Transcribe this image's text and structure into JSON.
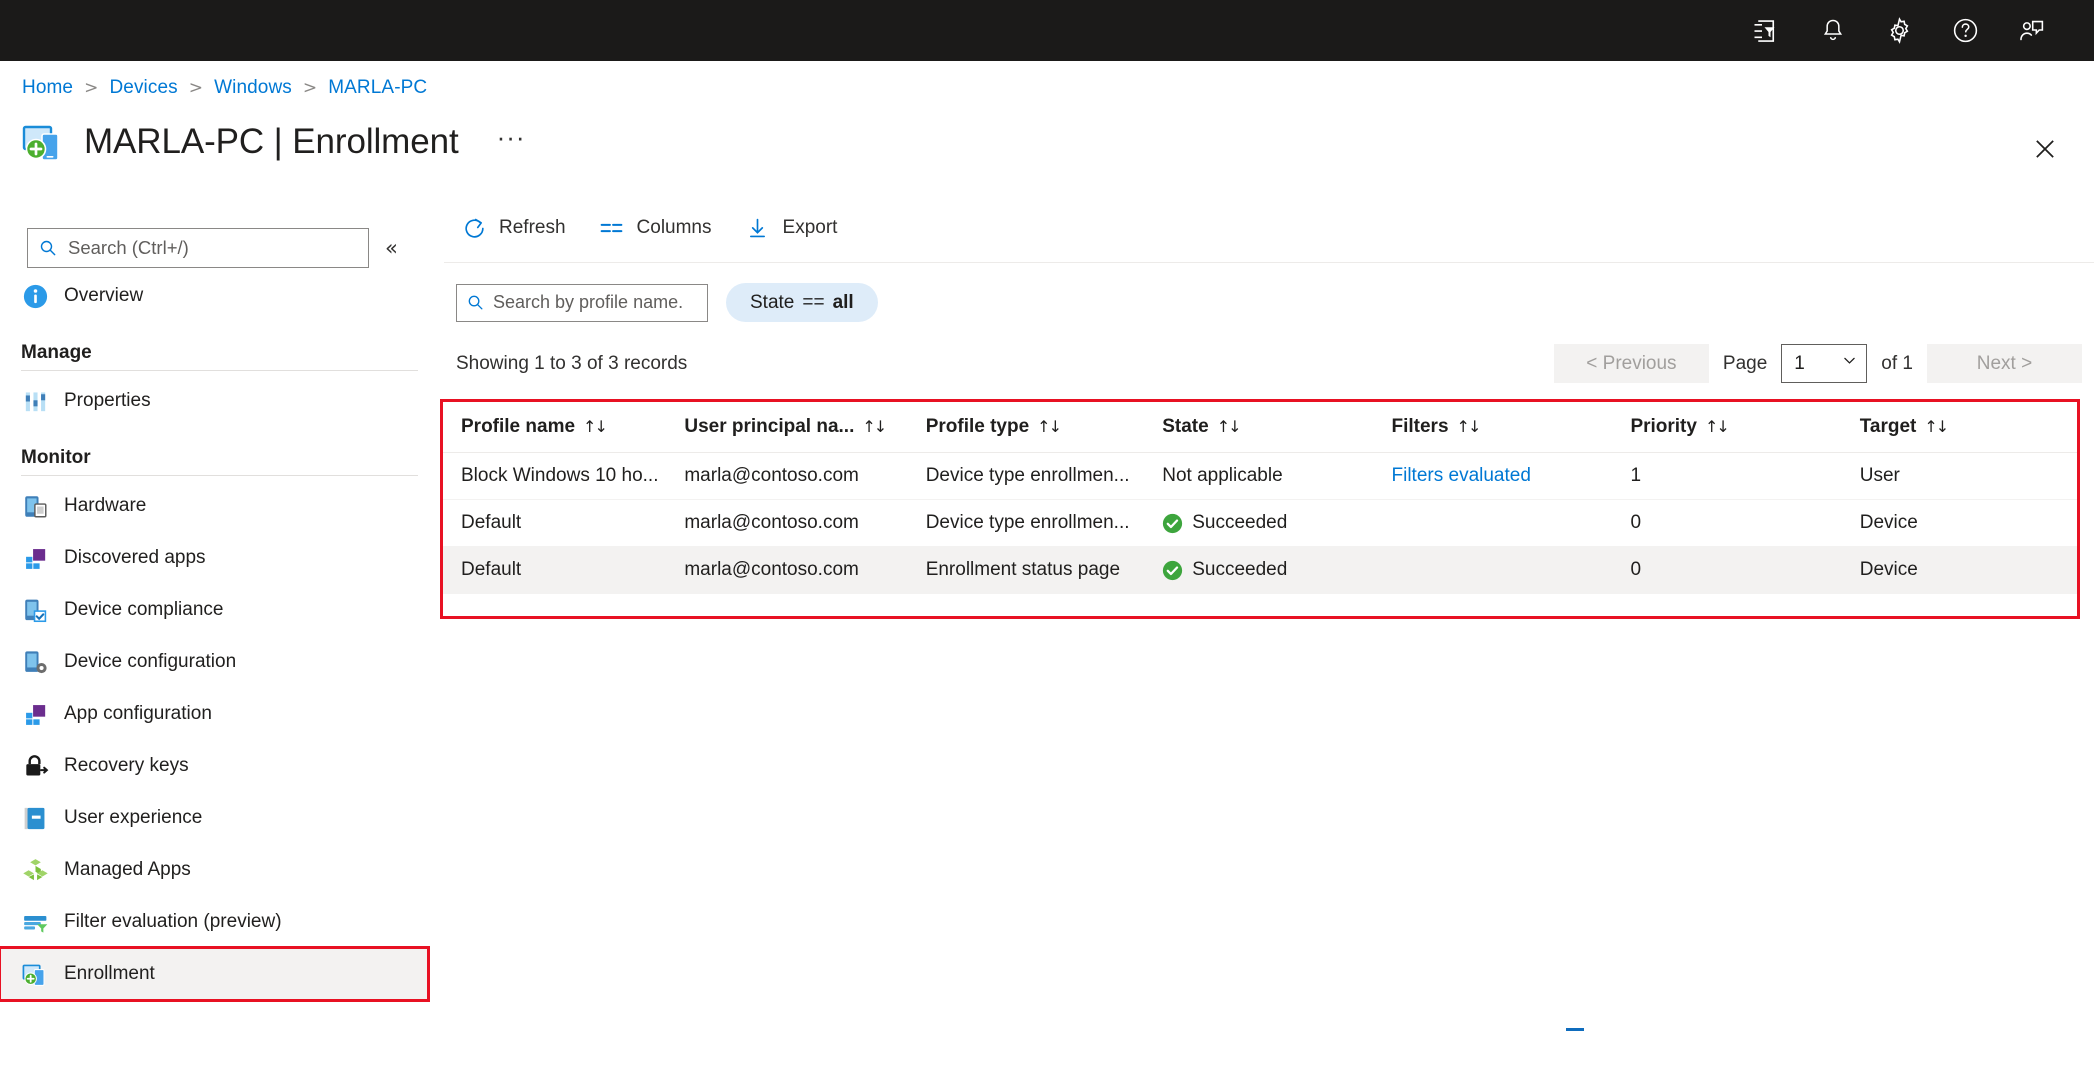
{
  "topbar": {
    "icons": [
      {
        "name": "directory-filter-icon",
        "label": "Directories + subscriptions"
      },
      {
        "name": "notifications-icon",
        "label": "Notifications"
      },
      {
        "name": "gear-icon",
        "label": "Settings"
      },
      {
        "name": "help-icon",
        "label": "Help"
      },
      {
        "name": "feedback-icon",
        "label": "Feedback"
      }
    ]
  },
  "breadcrumb": {
    "items": [
      "Home",
      "Devices",
      "Windows",
      "MARLA-PC"
    ],
    "separator": ">"
  },
  "header": {
    "title": "MARLA-PC | Enrollment",
    "device_name": "MARLA-PC",
    "page_name": "Enrollment",
    "more_label": "···",
    "close_label": "Close"
  },
  "sidebar": {
    "search": {
      "placeholder": "Search (Ctrl+/)",
      "value": ""
    },
    "collapse_label": "«",
    "items": [
      {
        "label": "Overview",
        "icon": "info-icon",
        "type": "item",
        "selected": false
      },
      {
        "label": "Manage",
        "type": "group"
      },
      {
        "label": "Properties",
        "icon": "properties-icon",
        "type": "item",
        "selected": false
      },
      {
        "label": "Monitor",
        "type": "group"
      },
      {
        "label": "Hardware",
        "icon": "hardware-icon",
        "type": "item",
        "selected": false
      },
      {
        "label": "Discovered apps",
        "icon": "discovered-apps-icon",
        "type": "item",
        "selected": false
      },
      {
        "label": "Device compliance",
        "icon": "device-compliance-icon",
        "type": "item",
        "selected": false
      },
      {
        "label": "Device configuration",
        "icon": "device-configuration-icon",
        "type": "item",
        "selected": false
      },
      {
        "label": "App configuration",
        "icon": "app-configuration-icon",
        "type": "item",
        "selected": false
      },
      {
        "label": "Recovery keys",
        "icon": "lock-key-icon",
        "type": "item",
        "selected": false
      },
      {
        "label": "User experience",
        "icon": "user-experience-icon",
        "type": "item",
        "selected": false
      },
      {
        "label": "Managed Apps",
        "icon": "managed-apps-icon",
        "type": "item",
        "selected": false
      },
      {
        "label": "Filter evaluation (preview)",
        "icon": "filter-evaluation-icon",
        "type": "item",
        "selected": false
      },
      {
        "label": "Enrollment",
        "icon": "enrollment-icon",
        "type": "item",
        "selected": true
      }
    ]
  },
  "toolbar": {
    "refresh_label": "Refresh",
    "columns_label": "Columns",
    "export_label": "Export"
  },
  "filters": {
    "search_placeholder": "Search by profile name.",
    "search_value": "",
    "pill": {
      "field": "State",
      "operator": "==",
      "value": "all"
    }
  },
  "pagination": {
    "records_text": "Showing 1 to 3 of 3 records",
    "previous_label": "< Previous",
    "next_label": "Next >",
    "page_label": "Page",
    "page_value": "1",
    "of_label": "of 1"
  },
  "table": {
    "columns": [
      {
        "label": "Profile name",
        "sortable": true
      },
      {
        "label": "User principal na...",
        "sortable": true
      },
      {
        "label": "Profile type",
        "sortable": true
      },
      {
        "label": "State",
        "sortable": true
      },
      {
        "label": "Filters",
        "sortable": true
      },
      {
        "label": "Priority",
        "sortable": true
      },
      {
        "label": "Target",
        "sortable": true
      }
    ],
    "sort_glyph": "↑↓",
    "rows": [
      {
        "profile_name": "Block Windows 10 ho...",
        "upn": "marla@contoso.com",
        "profile_type": "Device type enrollmen...",
        "state": "Not applicable",
        "state_ok": false,
        "filters": "Filters evaluated",
        "filters_is_link": true,
        "priority": "1",
        "target": "User",
        "alt": false
      },
      {
        "profile_name": "Default",
        "upn": "marla@contoso.com",
        "profile_type": "Device type enrollmen...",
        "state": "Succeeded",
        "state_ok": true,
        "filters": "",
        "filters_is_link": false,
        "priority": "0",
        "target": "Device",
        "alt": false
      },
      {
        "profile_name": "Default",
        "upn": "marla@contoso.com",
        "profile_type": "Enrollment status page",
        "state": "Succeeded",
        "state_ok": true,
        "filters": "",
        "filters_is_link": false,
        "priority": "0",
        "target": "Device",
        "alt": true
      }
    ]
  },
  "colors": {
    "accent": "#0078d4",
    "highlight_box": "#e81123",
    "success": "#3da53d",
    "topbar_bg": "#1b1a19",
    "pill_bg": "#deecf9",
    "row_alt_bg": "#f3f2f1"
  }
}
